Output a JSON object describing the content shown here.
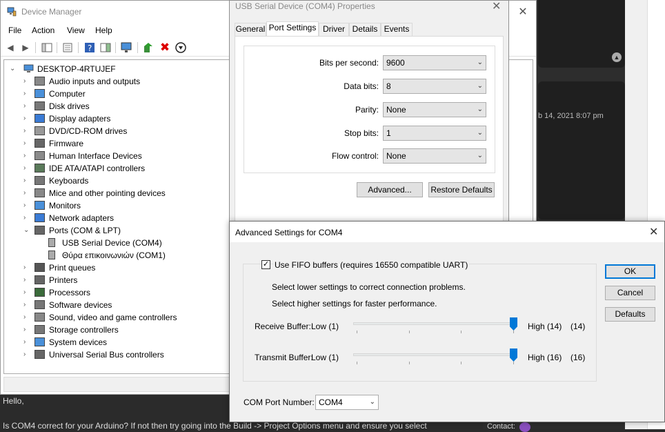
{
  "forum": {
    "date_fragment": "b 14, 2021 8:07 pm",
    "post_greeting": "Hello,",
    "post_line": "Is COM4 correct for your Arduino? If not then try going into the Build -> Project Options menu and ensure you select",
    "contact_label": "Contact:"
  },
  "device_manager": {
    "title": "Device Manager",
    "menu": [
      "File",
      "Action",
      "View",
      "Help"
    ],
    "computer_name": "DESKTOP-4RTUJEF",
    "categories": [
      "Audio inputs and outputs",
      "Computer",
      "Disk drives",
      "Display adapters",
      "DVD/CD-ROM drives",
      "Firmware",
      "Human Interface Devices",
      "IDE ATA/ATAPI controllers",
      "Keyboards",
      "Mice and other pointing devices",
      "Monitors",
      "Network adapters",
      "Ports (COM & LPT)",
      "Print queues",
      "Printers",
      "Processors",
      "Software devices",
      "Sound, video and game controllers",
      "Storage controllers",
      "System devices",
      "Universal Serial Bus controllers"
    ],
    "ports_children": [
      "USB Serial Device (COM4)",
      "Θύρα επικοινωνιών (COM1)"
    ]
  },
  "properties": {
    "title": "USB Serial Device (COM4) Properties",
    "tabs": [
      "General",
      "Port Settings",
      "Driver",
      "Details",
      "Events"
    ],
    "active_tab": "Port Settings",
    "fields": [
      {
        "label": "Bits per second:",
        "value": "9600"
      },
      {
        "label": "Data bits:",
        "value": "8"
      },
      {
        "label": "Parity:",
        "value": "None"
      },
      {
        "label": "Stop bits:",
        "value": "1"
      },
      {
        "label": "Flow control:",
        "value": "None"
      }
    ],
    "advanced_button": "Advanced...",
    "restore_button": "Restore Defaults"
  },
  "advanced": {
    "title": "Advanced Settings for COM4",
    "fifo_label": "Use FIFO buffers (requires 16550 compatible UART)",
    "fifo_checked": true,
    "hint_lower": "Select lower settings to correct connection problems.",
    "hint_higher": "Select higher settings for faster performance.",
    "receive": {
      "label": "Receive Buffer:",
      "low": "Low (1)",
      "high": "High (14)",
      "value": "(14)",
      "level": 1.0
    },
    "transmit": {
      "label": "Transmit Buffer:",
      "low": "Low (1)",
      "high": "High (16)",
      "value": "(16)",
      "level": 1.0
    },
    "com_port_label": "COM Port Number:",
    "com_port_value": "COM4",
    "ok_button": "OK",
    "cancel_button": "Cancel",
    "defaults_button": "Defaults"
  }
}
